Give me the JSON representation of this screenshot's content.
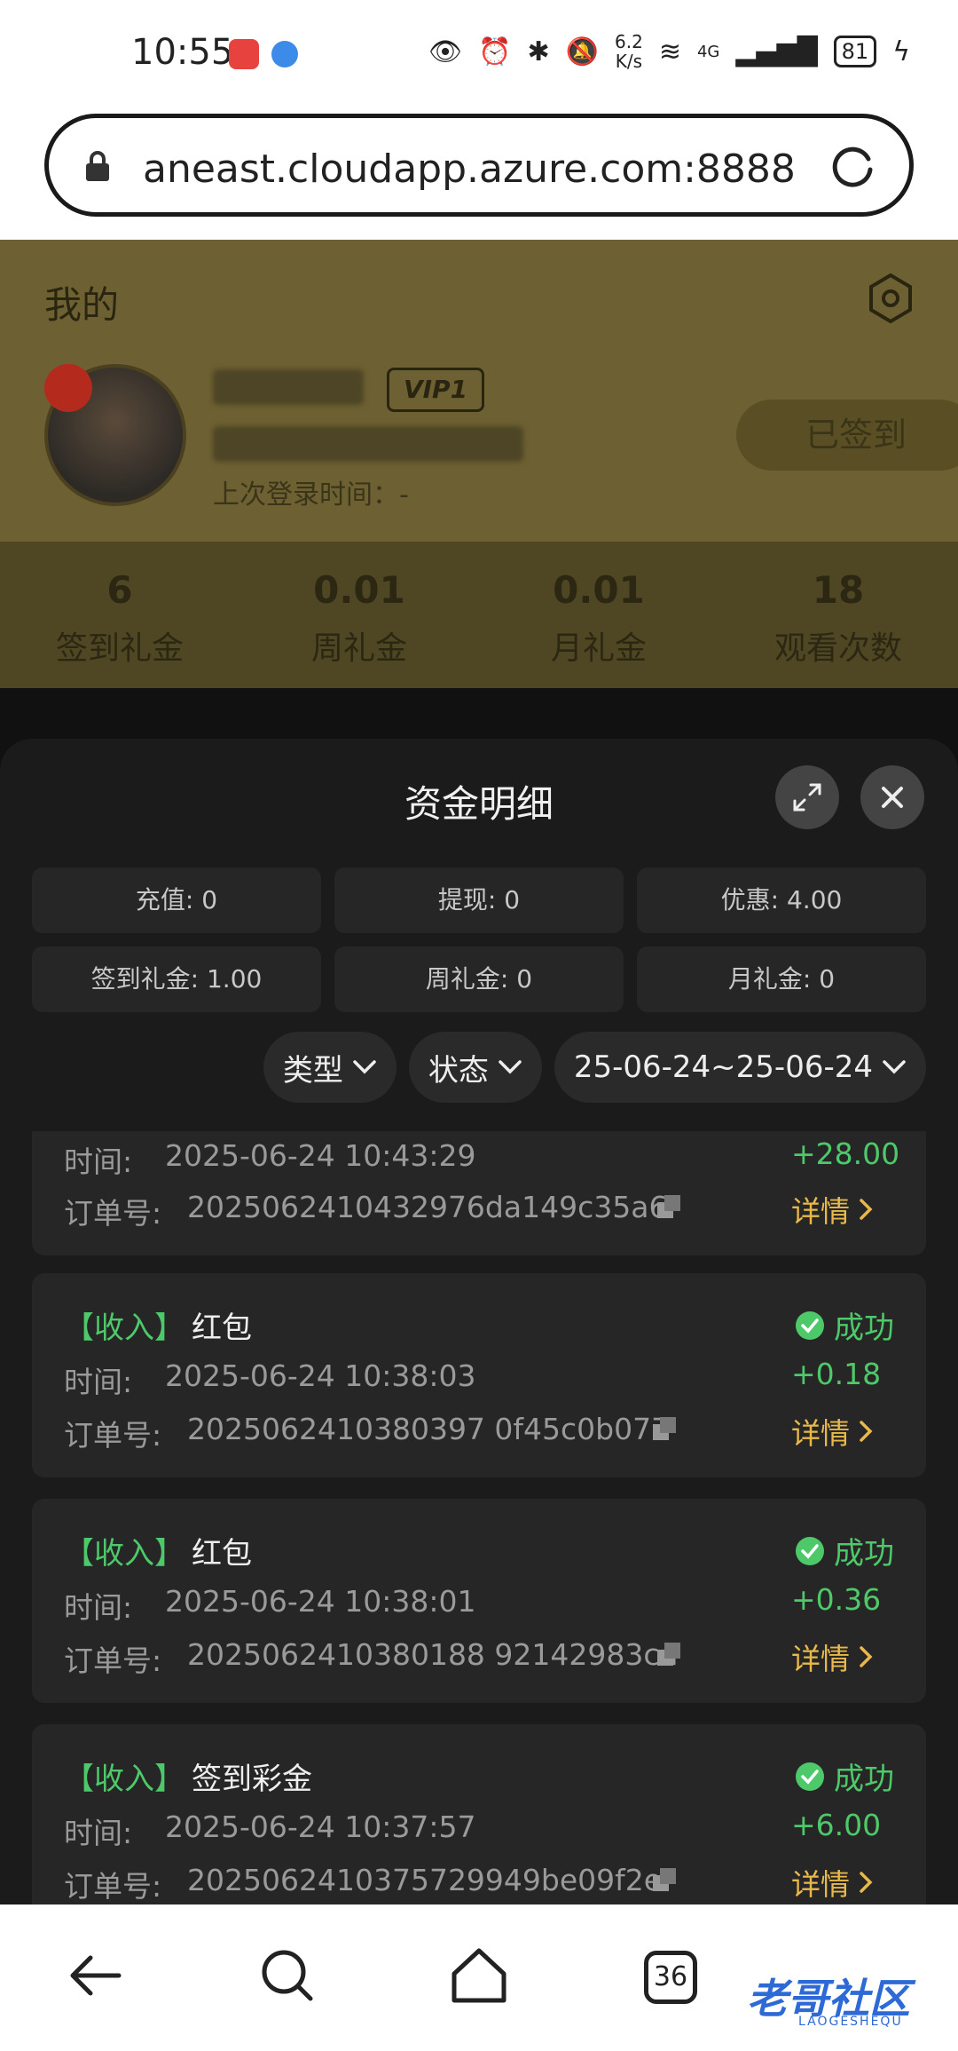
{
  "status_bar": {
    "time": "10:55",
    "net_speed_top": "6.2",
    "net_speed_bottom": "K/s",
    "network": "4G",
    "battery": "81"
  },
  "browser": {
    "url": "aneast.cloudapp.azure.com:8888"
  },
  "profile": {
    "title": "我的",
    "vip_badge": "VIP1",
    "last_login": "上次登录时间：-",
    "checked_in_button": "已签到",
    "stats": [
      {
        "value": "6",
        "label": "签到礼金"
      },
      {
        "value": "0.01",
        "label": "周礼金"
      },
      {
        "value": "0.01",
        "label": "月礼金"
      },
      {
        "value": "18",
        "label": "观看次数"
      }
    ]
  },
  "sheet": {
    "title": "资金明细",
    "summary": [
      "充值: 0",
      "提现: 0",
      "优惠: 4.00",
      "签到礼金: 1.00",
      "周礼金: 0",
      "月礼金: 0"
    ],
    "filters": {
      "type": "类型",
      "status": "状态",
      "date_range": "25-06-24~25-06-24"
    },
    "time_label": "时间:",
    "order_label": "订单号:",
    "detail_label": "详情",
    "records": [
      {
        "type": "",
        "name": "",
        "time": "2025-06-24 10:43:29",
        "order_no": "2025062410432976da149c35a6",
        "status": "",
        "amount": "+28.00"
      },
      {
        "type": "【收入】",
        "name": "红包",
        "time": "2025-06-24 10:38:03",
        "order_no": "2025062410380397 0f45c0b077",
        "status": "成功",
        "amount": "+0.18"
      },
      {
        "type": "【收入】",
        "name": "红包",
        "time": "2025-06-24 10:38:01",
        "order_no": "2025062410380188 92142983cd",
        "status": "成功",
        "amount": "+0.36"
      },
      {
        "type": "【收入】",
        "name": "签到彩金",
        "time": "2025-06-24 10:37:57",
        "order_no": "2025062410375729949be09f2e",
        "status": "成功",
        "amount": "+6.00"
      }
    ]
  },
  "navbar": {
    "tab_count": "36",
    "watermark": "老哥社区",
    "watermark_sub": "LAOGESHEQU"
  },
  "colors": {
    "success": "#4ec96a",
    "detail": "#e8b84a",
    "profile_bg": "#6d6032"
  }
}
